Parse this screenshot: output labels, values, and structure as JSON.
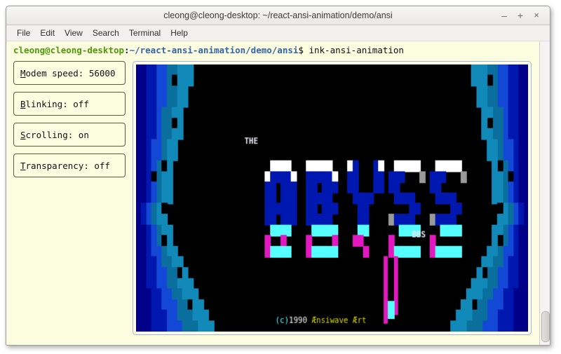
{
  "window": {
    "title": "cleong@cleong-desktop: ~/react-ansi-animation/demo/ansi",
    "controls": {
      "minimize": "–",
      "maximize": "+",
      "close": "×"
    }
  },
  "menubar": {
    "items": [
      {
        "label": "File"
      },
      {
        "label": "Edit"
      },
      {
        "label": "View"
      },
      {
        "label": "Search"
      },
      {
        "label": "Terminal"
      },
      {
        "label": "Help"
      }
    ]
  },
  "terminal": {
    "prompt": {
      "user_host": "cleong@cleong-desktop",
      "colon": ":",
      "path": "~/react-ansi-animation/demo/ansi",
      "dollar": "$",
      "command": "ink-ansi-animation"
    },
    "colors": {
      "background": "#fcfce0",
      "user_host": "#4e9a06",
      "path": "#3465a4",
      "text": "#0c0c0c"
    }
  },
  "sidebar": {
    "options": [
      {
        "accel": "M",
        "rest": "odem speed: 56000",
        "name": "modem-speed"
      },
      {
        "accel": "B",
        "rest": "linking: off",
        "name": "blinking"
      },
      {
        "accel": "S",
        "rest": "crolling: on",
        "name": "scrolling"
      },
      {
        "accel": "T",
        "rest": "ransparency: off",
        "name": "transparency"
      }
    ]
  },
  "ansi_art": {
    "title": "THE",
    "logo": "ABYSS",
    "subtitle": "BBS",
    "credit_paren": "(c)",
    "credit_year": "1990 ",
    "credit_author": "Ænsiwave Ært",
    "palette": {
      "black": "#000000",
      "navy": "#000088",
      "blue": "#0018b0",
      "bright_blue": "#1347d6",
      "teal": "#0b6f9e",
      "cyan_dark": "#1189b9",
      "cyan": "#55ffff",
      "magenta": "#e318c0",
      "white": "#ffffff",
      "grey": "#9a9a9a",
      "yellow": "#d6d600"
    }
  },
  "scrollbar": {
    "name": "vertical-scrollbar"
  }
}
